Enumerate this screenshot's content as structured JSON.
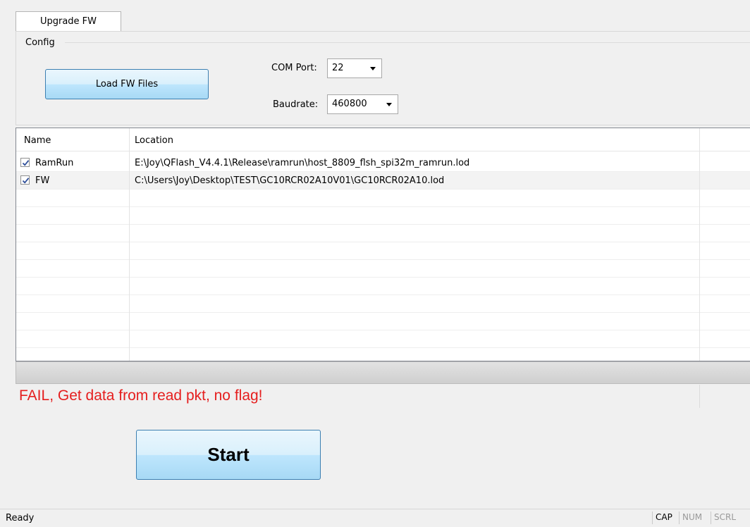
{
  "tabs": [
    {
      "label": "Upgrade FW",
      "active": true
    }
  ],
  "config": {
    "group_label": "Config",
    "load_button": "Load FW Files",
    "com_port": {
      "label": "COM Port:",
      "value": "22"
    },
    "baudrate": {
      "label": "Baudrate:",
      "value": "460800"
    }
  },
  "table": {
    "columns": [
      "Name",
      "Location"
    ],
    "rows": [
      {
        "name": "RamRun",
        "checked": true,
        "location": "E:\\Joy\\QFlash_V4.4.1\\Release\\ramrun\\host_8809_flsh_spi32m_ramrun.lod"
      },
      {
        "name": "FW",
        "checked": true,
        "location": "C:\\Users\\Joy\\Desktop\\TEST\\GC10RCR02A10V01\\GC10RCR02A10.lod"
      }
    ]
  },
  "status_message": "FAIL, Get data from read pkt, no flag!",
  "start_button": "Start",
  "statusbar": {
    "ready": "Ready",
    "indicators": [
      {
        "label": "CAP",
        "active": true
      },
      {
        "label": "NUM",
        "active": false
      },
      {
        "label": "SCRL",
        "active": false
      }
    ]
  },
  "colors": {
    "error_text": "#e51e1e",
    "button_border": "#3c7fb1",
    "check_mark": "#2f4f9a"
  }
}
